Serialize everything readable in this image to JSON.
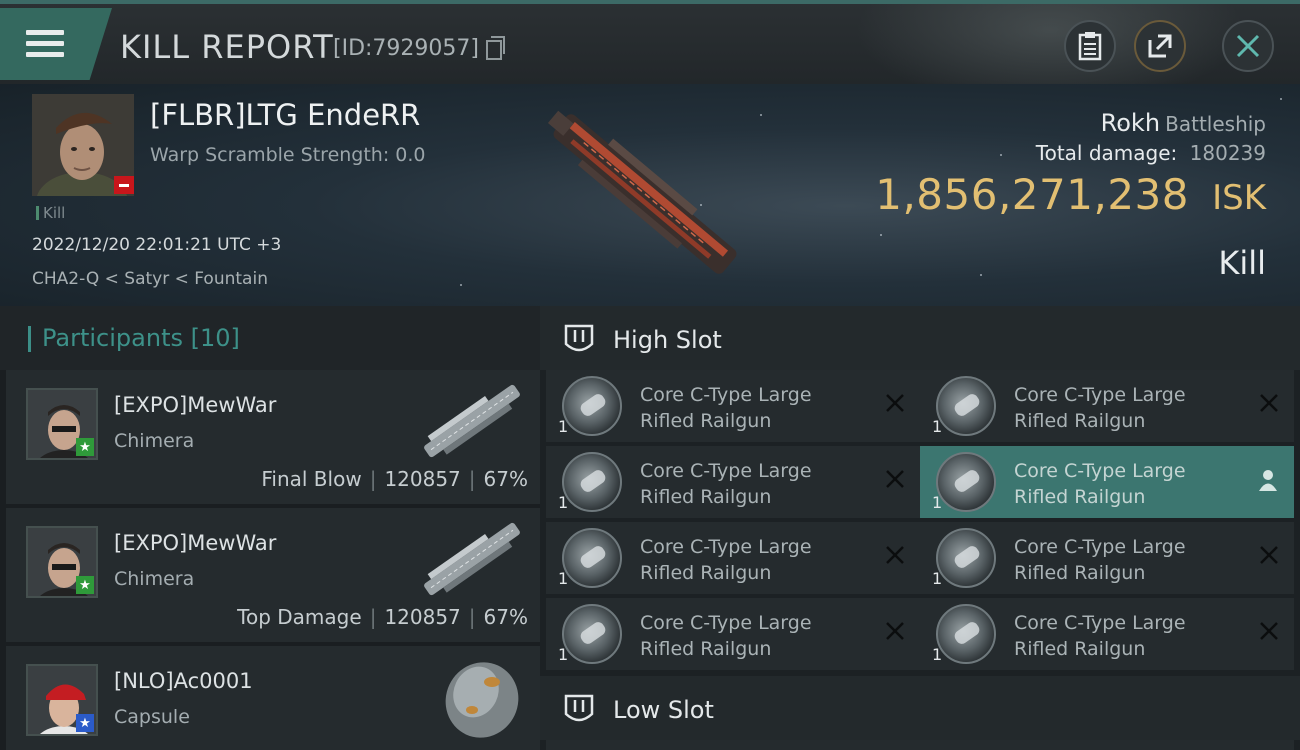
{
  "header": {
    "title": "KILL REPORT",
    "report_id": "[ID:7929057]",
    "icons": [
      "menu-icon",
      "copy-icon",
      "clipboard-icon",
      "share-icon",
      "close-icon"
    ],
    "accent_color": "#34695f"
  },
  "victim": {
    "name": "[FLBR]LTG EndeRR",
    "warp_scramble": "Warp Scramble Strength: 0.0",
    "kill_tag": "Kill",
    "datetime": "2022/12/20 22:01:21 UTC +3",
    "location": "CHA2-Q < Satyr < Fountain",
    "ship_name": "Rokh",
    "ship_class": "Battleship",
    "total_damage_label": "Total damage:",
    "total_damage_value": "180239",
    "isk_value": "1,856,271,238",
    "isk_unit": "ISK",
    "result": "Kill",
    "isk_color": "#e2bf72"
  },
  "participants": {
    "title": "Participants",
    "count": "[10]",
    "rows": [
      {
        "name": "[EXPO]MewWar",
        "ship": "Chimera",
        "label": "Final Blow",
        "damage": "120857",
        "percent": "67%",
        "badge": "★",
        "badge_color": "#2f9a3a"
      },
      {
        "name": "[EXPO]MewWar",
        "ship": "Chimera",
        "label": "Top Damage",
        "damage": "120857",
        "percent": "67%",
        "badge": "★",
        "badge_color": "#2f9a3a"
      },
      {
        "name": "[NLO]Ac0001",
        "ship": "Capsule",
        "label": "",
        "damage": "",
        "percent": "",
        "badge": "★",
        "badge_color": "#2b5bc9"
      }
    ]
  },
  "slots": {
    "high_title": "High Slot",
    "low_title": "Low Slot",
    "items": [
      {
        "qty": "1",
        "line1": "Core C-Type Large",
        "line2": "Rifled Railgun"
      },
      {
        "qty": "1",
        "line1": "Core C-Type Large",
        "line2": "Rifled Railgun"
      },
      {
        "qty": "1",
        "line1": "Core C-Type Large",
        "line2": "Rifled Railgun"
      },
      {
        "qty": "1",
        "line1": "Core C-Type Large",
        "line2": "Rifled Railgun"
      },
      {
        "qty": "1",
        "line1": "Core C-Type Large",
        "line2": "Rifled Railgun"
      },
      {
        "qty": "1",
        "line1": "Core C-Type Large",
        "line2": "Rifled Railgun"
      },
      {
        "qty": "1",
        "line1": "Core C-Type Large",
        "line2": "Rifled Railgun"
      },
      {
        "qty": "1",
        "line1": "Core C-Type Large",
        "line2": "Rifled Railgun"
      }
    ]
  }
}
